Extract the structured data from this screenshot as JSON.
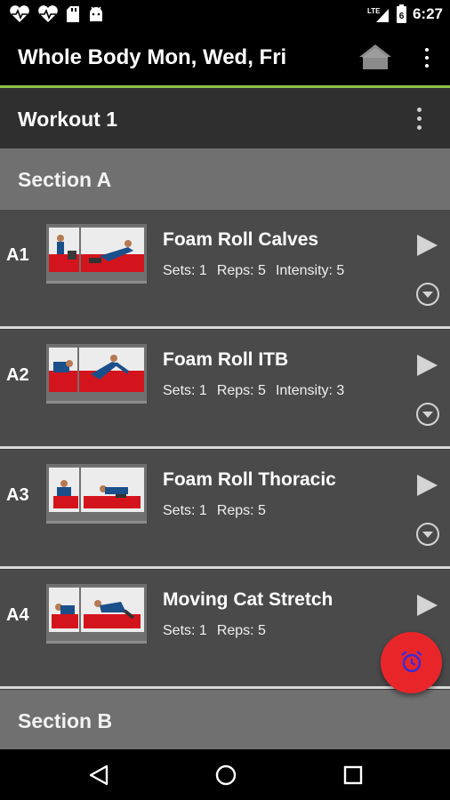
{
  "status_bar": {
    "time": "6:27",
    "network": "LTE",
    "battery_level": "6",
    "icons": [
      "heart-pulse-icon",
      "heart-pulse-icon",
      "sd-card-icon",
      "android-icon",
      "signal-icon",
      "battery-icon"
    ]
  },
  "app_bar": {
    "title": "Whole Body Mon, Wed, Fri",
    "home_icon": "home-icon",
    "menu_icon": "more-vert-icon"
  },
  "workout": {
    "title": "Workout 1",
    "menu_icon": "more-vert-icon"
  },
  "sections": [
    {
      "label": "Section A",
      "exercises": [
        {
          "code": "A1",
          "name": "Foam Roll Calves",
          "sets": "Sets: 1",
          "reps": "Reps: 5",
          "intensity": "Intensity: 5"
        },
        {
          "code": "A2",
          "name": "Foam Roll ITB",
          "sets": "Sets: 1",
          "reps": "Reps: 5",
          "intensity": "Intensity: 3"
        },
        {
          "code": "A3",
          "name": "Foam Roll Thoracic",
          "sets": "Sets: 1",
          "reps": "Reps: 5"
        },
        {
          "code": "A4",
          "name": "Moving Cat Stretch",
          "sets": "Sets: 1",
          "reps": "Reps: 5"
        }
      ]
    },
    {
      "label": "Section B",
      "exercises": []
    }
  ],
  "fab": {
    "icon": "alarm-clock-icon",
    "color": "#e8262a"
  },
  "colors": {
    "accent": "#8bc34a",
    "row_bg": "#4a4a4a",
    "section_bg": "#707070"
  },
  "nav_bar": {
    "icons": [
      "back-icon",
      "home-circle-icon",
      "recents-icon"
    ]
  }
}
